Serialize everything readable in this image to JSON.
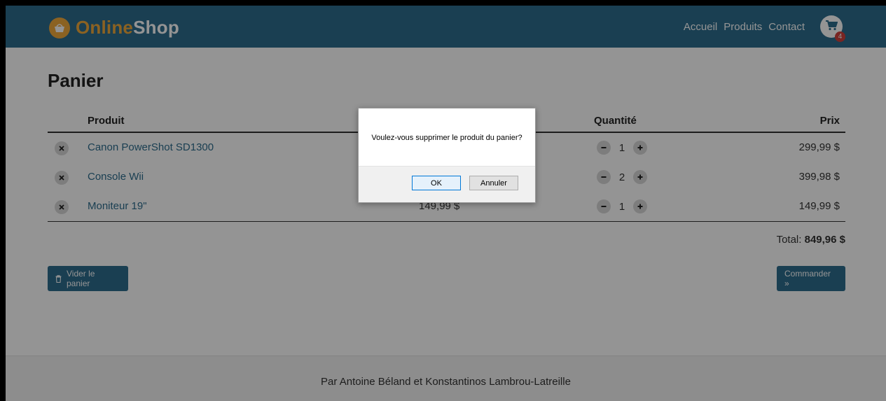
{
  "header": {
    "logo_part1": "Online",
    "logo_part2": "Shop",
    "nav": [
      "Accueil",
      "Produits",
      "Contact"
    ],
    "cart_count": "4"
  },
  "page": {
    "title": "Panier"
  },
  "table": {
    "columns": [
      "Produit",
      "Quantité",
      "Prix"
    ],
    "rows": [
      {
        "name": "Canon PowerShot SD1300",
        "unit_price": "",
        "qty": "1",
        "price": "299,99 $"
      },
      {
        "name": "Console Wii",
        "unit_price": "",
        "qty": "2",
        "price": "399,98 $"
      },
      {
        "name": "Moniteur 19\"",
        "unit_price": "149,99 $",
        "qty": "1",
        "price": "149,99 $"
      }
    ]
  },
  "total": {
    "label": "Total:",
    "value": "849,96 $"
  },
  "buttons": {
    "clear": "Vider le panier",
    "order": "Commander »"
  },
  "footer": {
    "text": "Par Antoine Béland et Konstantinos Lambrou-Latreille"
  },
  "dialog": {
    "message": "Voulez-vous supprimer le produit du panier?",
    "ok": "OK",
    "cancel": "Annuler"
  },
  "icons": {
    "logo": "basket-icon",
    "cart": "cart-icon",
    "remove": "close-icon",
    "minus": "minus-icon",
    "plus": "plus-icon",
    "trash": "trash-icon"
  },
  "colors": {
    "primary": "#2e6d8e",
    "accent": "#f0a93c",
    "badge": "#d0413b"
  }
}
